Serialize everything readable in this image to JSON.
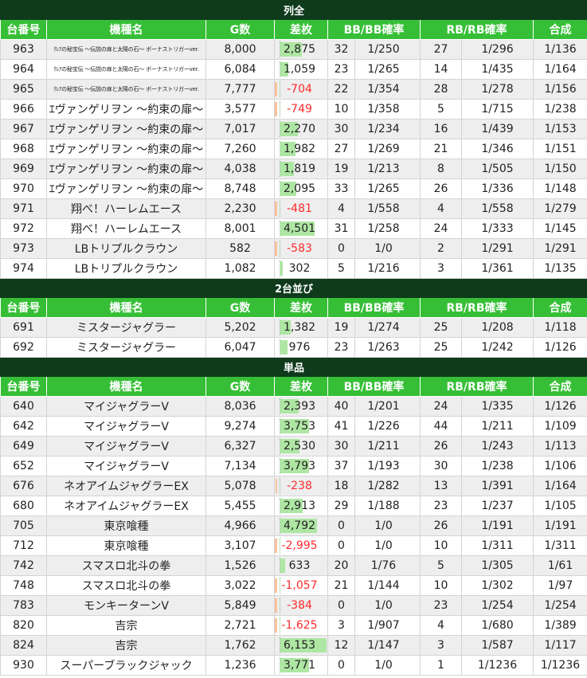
{
  "columns": [
    "台番号",
    "機種名",
    "G数",
    "差枚",
    "BB/BB確率",
    "RB/RB確率",
    "合成"
  ],
  "sections": [
    {
      "title": "列全",
      "rows": [
        {
          "no": "963",
          "name": "ｸﾚｱの秘宝伝 ～伝説の扉と太陽の石～ ボーナストリガーver.",
          "small": true,
          "g": "8,000",
          "diff": "2,875",
          "diffValue": 2875,
          "bb": "32",
          "bbRate": "1/250",
          "rb": "27",
          "rbRate": "1/296",
          "total": "1/136"
        },
        {
          "no": "964",
          "name": "ｸﾚｱの秘宝伝 ～伝説の扉と太陽の石～ ボーナストリガーver.",
          "small": true,
          "g": "6,084",
          "diff": "1,059",
          "diffValue": 1059,
          "bb": "23",
          "bbRate": "1/265",
          "rb": "14",
          "rbRate": "1/435",
          "total": "1/164"
        },
        {
          "no": "965",
          "name": "ｸﾚｱの秘宝伝 ～伝説の扉と太陽の石～ ボーナストリガーver.",
          "small": true,
          "g": "7,777",
          "diff": "-704",
          "diffValue": -704,
          "bb": "22",
          "bbRate": "1/354",
          "rb": "28",
          "rbRate": "1/278",
          "total": "1/156"
        },
        {
          "no": "966",
          "name": "ｴヴァンゲリヲン ～約束の扉～",
          "small": false,
          "g": "3,577",
          "diff": "-749",
          "diffValue": -749,
          "bb": "10",
          "bbRate": "1/358",
          "rb": "5",
          "rbRate": "1/715",
          "total": "1/238"
        },
        {
          "no": "967",
          "name": "ｴヴァンゲリヲン ～約束の扉～",
          "small": false,
          "g": "7,017",
          "diff": "2,270",
          "diffValue": 2270,
          "bb": "30",
          "bbRate": "1/234",
          "rb": "16",
          "rbRate": "1/439",
          "total": "1/153"
        },
        {
          "no": "968",
          "name": "ｴヴァンゲリヲン ～約束の扉～",
          "small": false,
          "g": "7,260",
          "diff": "1,982",
          "diffValue": 1982,
          "bb": "27",
          "bbRate": "1/269",
          "rb": "21",
          "rbRate": "1/346",
          "total": "1/151"
        },
        {
          "no": "969",
          "name": "ｴヴァンゲリヲン ～約束の扉～",
          "small": false,
          "g": "4,038",
          "diff": "1,819",
          "diffValue": 1819,
          "bb": "19",
          "bbRate": "1/213",
          "rb": "8",
          "rbRate": "1/505",
          "total": "1/150"
        },
        {
          "no": "970",
          "name": "ｴヴァンゲリヲン ～約束の扉～",
          "small": false,
          "g": "8,748",
          "diff": "2,095",
          "diffValue": 2095,
          "bb": "33",
          "bbRate": "1/265",
          "rb": "26",
          "rbRate": "1/336",
          "total": "1/148"
        },
        {
          "no": "971",
          "name": "翔べ！ハーレムエース",
          "small": false,
          "g": "2,230",
          "diff": "-481",
          "diffValue": -481,
          "bb": "4",
          "bbRate": "1/558",
          "rb": "4",
          "rbRate": "1/558",
          "total": "1/279"
        },
        {
          "no": "972",
          "name": "翔べ！ハーレムエース",
          "small": false,
          "g": "8,001",
          "diff": "4,501",
          "diffValue": 4501,
          "bb": "31",
          "bbRate": "1/258",
          "rb": "24",
          "rbRate": "1/333",
          "total": "1/145"
        },
        {
          "no": "973",
          "name": "LBトリプルクラウン",
          "small": false,
          "g": "582",
          "diff": "-583",
          "diffValue": -583,
          "bb": "0",
          "bbRate": "1/0",
          "rb": "2",
          "rbRate": "1/291",
          "total": "1/291"
        },
        {
          "no": "974",
          "name": "LBトリプルクラウン",
          "small": false,
          "g": "1,082",
          "diff": "302",
          "diffValue": 302,
          "bb": "5",
          "bbRate": "1/216",
          "rb": "3",
          "rbRate": "1/361",
          "total": "1/135"
        }
      ]
    },
    {
      "title": "2台並び",
      "rows": [
        {
          "no": "691",
          "name": "ミスタージャグラー",
          "small": false,
          "g": "5,202",
          "diff": "1,382",
          "diffValue": 1382,
          "bb": "19",
          "bbRate": "1/274",
          "rb": "25",
          "rbRate": "1/208",
          "total": "1/118"
        },
        {
          "no": "692",
          "name": "ミスタージャグラー",
          "small": false,
          "g": "6,047",
          "diff": "976",
          "diffValue": 976,
          "bb": "23",
          "bbRate": "1/263",
          "rb": "25",
          "rbRate": "1/242",
          "total": "1/126"
        }
      ]
    },
    {
      "title": "単品",
      "rows": [
        {
          "no": "640",
          "name": "マイジャグラーV",
          "small": false,
          "g": "8,036",
          "diff": "2,393",
          "diffValue": 2393,
          "bb": "40",
          "bbRate": "1/201",
          "rb": "24",
          "rbRate": "1/335",
          "total": "1/126"
        },
        {
          "no": "642",
          "name": "マイジャグラーV",
          "small": false,
          "g": "9,274",
          "diff": "3,753",
          "diffValue": 3753,
          "bb": "41",
          "bbRate": "1/226",
          "rb": "44",
          "rbRate": "1/211",
          "total": "1/109"
        },
        {
          "no": "649",
          "name": "マイジャグラーV",
          "small": false,
          "g": "6,327",
          "diff": "2,530",
          "diffValue": 2530,
          "bb": "30",
          "bbRate": "1/211",
          "rb": "26",
          "rbRate": "1/243",
          "total": "1/113"
        },
        {
          "no": "652",
          "name": "マイジャグラーV",
          "small": false,
          "g": "7,134",
          "diff": "3,793",
          "diffValue": 3793,
          "bb": "37",
          "bbRate": "1/193",
          "rb": "30",
          "rbRate": "1/238",
          "total": "1/106"
        },
        {
          "no": "676",
          "name": "ネオアイムジャグラーEX",
          "small": false,
          "g": "5,078",
          "diff": "-238",
          "diffValue": -238,
          "bb": "18",
          "bbRate": "1/282",
          "rb": "13",
          "rbRate": "1/391",
          "total": "1/164"
        },
        {
          "no": "680",
          "name": "ネオアイムジャグラーEX",
          "small": false,
          "g": "5,455",
          "diff": "2,913",
          "diffValue": 2913,
          "bb": "29",
          "bbRate": "1/188",
          "rb": "23",
          "rbRate": "1/237",
          "total": "1/105"
        },
        {
          "no": "705",
          "name": "東京喰種",
          "small": false,
          "g": "4,966",
          "diff": "4,792",
          "diffValue": 4792,
          "bb": "0",
          "bbRate": "1/0",
          "rb": "26",
          "rbRate": "1/191",
          "total": "1/191"
        },
        {
          "no": "712",
          "name": "東京喰種",
          "small": false,
          "g": "3,107",
          "diff": "-2,995",
          "diffValue": -2995,
          "bb": "0",
          "bbRate": "1/0",
          "rb": "10",
          "rbRate": "1/311",
          "total": "1/311"
        },
        {
          "no": "742",
          "name": "スマスロ北斗の拳",
          "small": false,
          "g": "1,526",
          "diff": "633",
          "diffValue": 633,
          "bb": "20",
          "bbRate": "1/76",
          "rb": "5",
          "rbRate": "1/305",
          "total": "1/61"
        },
        {
          "no": "748",
          "name": "スマスロ北斗の拳",
          "small": false,
          "g": "3,022",
          "diff": "-1,057",
          "diffValue": -1057,
          "bb": "21",
          "bbRate": "1/144",
          "rb": "10",
          "rbRate": "1/302",
          "total": "1/97"
        },
        {
          "no": "783",
          "name": "モンキーターンV",
          "small": false,
          "g": "5,849",
          "diff": "-384",
          "diffValue": -384,
          "bb": "0",
          "bbRate": "1/0",
          "rb": "23",
          "rbRate": "1/254",
          "total": "1/254"
        },
        {
          "no": "820",
          "name": "吉宗",
          "small": false,
          "g": "2,721",
          "diff": "-1,625",
          "diffValue": -1625,
          "bb": "3",
          "bbRate": "1/907",
          "rb": "4",
          "rbRate": "1/680",
          "total": "1/389"
        },
        {
          "no": "824",
          "name": "吉宗",
          "small": false,
          "g": "1,762",
          "diff": "6,153",
          "diffValue": 6153,
          "bb": "12",
          "bbRate": "1/147",
          "rb": "3",
          "rbRate": "1/587",
          "total": "1/117"
        },
        {
          "no": "930",
          "name": "スーパーブラックジャック",
          "small": false,
          "g": "1,236",
          "diff": "3,771",
          "diffValue": 3771,
          "bb": "0",
          "bbRate": "1/0",
          "rb": "1",
          "rbRate": "1/1236",
          "total": "1/1236"
        }
      ]
    }
  ],
  "colors": {
    "section_bg": "#0f3a1c",
    "header_bg": "#36bf36",
    "positive_bar": "#aee6a3",
    "negative_bar": "#f8c29d",
    "negative_text": "#ff2a2a",
    "alt_row": "#eeeeee"
  }
}
